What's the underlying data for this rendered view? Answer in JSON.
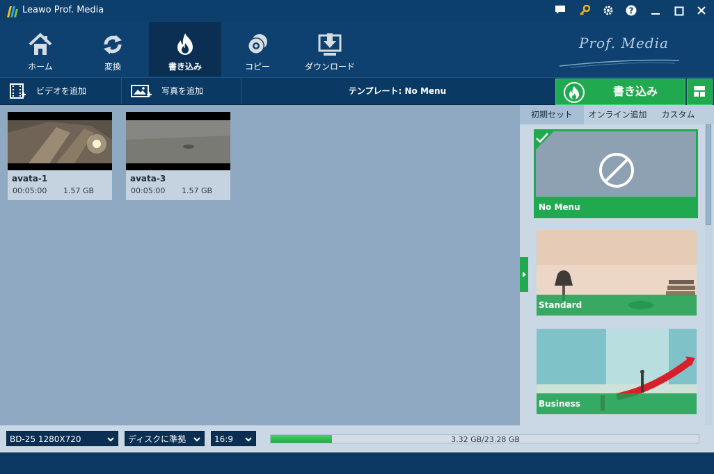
{
  "app": {
    "title": "Leawo Prof. Media",
    "brand": "Prof. Media"
  },
  "title_icons": [
    "chat-icon",
    "key-icon",
    "gear-icon",
    "help-icon"
  ],
  "nav": {
    "tabs": [
      {
        "label": "ホーム",
        "icon": "home-icon"
      },
      {
        "label": "変換",
        "icon": "convert-icon"
      },
      {
        "label": "書き込み",
        "icon": "burn-icon",
        "active": true
      },
      {
        "label": "コピー",
        "icon": "copy-icon"
      },
      {
        "label": "ダウンロード",
        "icon": "download-icon"
      }
    ]
  },
  "toolbar": {
    "add_video": "ビデオを追加",
    "add_photo": "写真を追加",
    "template_label": "テンプレート: No Menu",
    "burn_label": "書き込み"
  },
  "videos": [
    {
      "name": "avata-1",
      "duration": "00:05:00",
      "size": "1.57 GB"
    },
    {
      "name": "avata-3",
      "duration": "00:05:00",
      "size": "1.57 GB"
    }
  ],
  "panel": {
    "tabs": [
      "初期セット",
      "オンライン追加",
      "カスタム"
    ],
    "templates": [
      {
        "label": "No Menu",
        "selected": true
      },
      {
        "label": "Standard"
      },
      {
        "label": "Business"
      }
    ]
  },
  "bottom": {
    "disc_type": "BD-25 1280X720",
    "quality": "ディスクに準拠",
    "aspect": "16:9",
    "progress_text": "3.32 GB/23.28 GB",
    "progress_fraction": 0.1426
  },
  "colors": {
    "accent": "#21a94f",
    "dark": "#0b3963",
    "workspace": "#8ea9c1"
  }
}
